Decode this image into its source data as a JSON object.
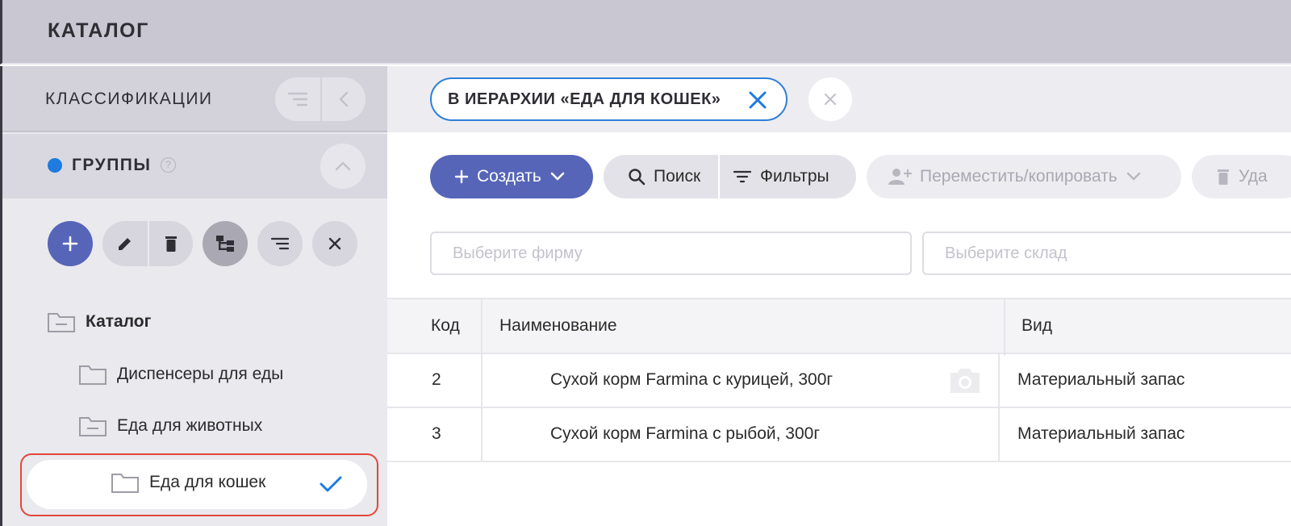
{
  "header": {
    "title": "КАТАЛОГ"
  },
  "sidebar": {
    "classifications_label": "КЛАССИФИКАЦИИ",
    "groups_label": "ГРУППЫ",
    "groups_help": "?",
    "accent_color": "#1e7be0",
    "tree": [
      {
        "label": "Каталог",
        "icon": "folder-minus-icon",
        "bold": true
      },
      {
        "label": "Диспенсеры для еды",
        "icon": "folder-icon"
      },
      {
        "label": "Еда для животных",
        "icon": "folder-minus-icon"
      },
      {
        "label": "Еда для кошек",
        "icon": "folder-icon",
        "selected": true
      }
    ]
  },
  "filter": {
    "chip_label": "В ИЕРАРХИИ «ЕДА ДЛЯ КОШЕК»"
  },
  "toolbar": {
    "create_label": "Создать",
    "search_label": "Поиск",
    "filters_label": "Фильтры",
    "move_label": "Переместить/копировать",
    "delete_label": "Уда",
    "primary_color": "#5665b8"
  },
  "fields": {
    "firm_placeholder": "Выберите фирму",
    "warehouse_placeholder": "Выберите склад"
  },
  "table": {
    "columns": [
      "Код",
      "Наименование",
      "Вид"
    ],
    "rows": [
      {
        "code": "2",
        "name": "Сухой корм Farmina с курицей, 300г",
        "kind": "Материальный запас"
      },
      {
        "code": "3",
        "name": "Сухой корм Farmina с рыбой, 300г",
        "kind": "Материальный запас"
      }
    ]
  }
}
